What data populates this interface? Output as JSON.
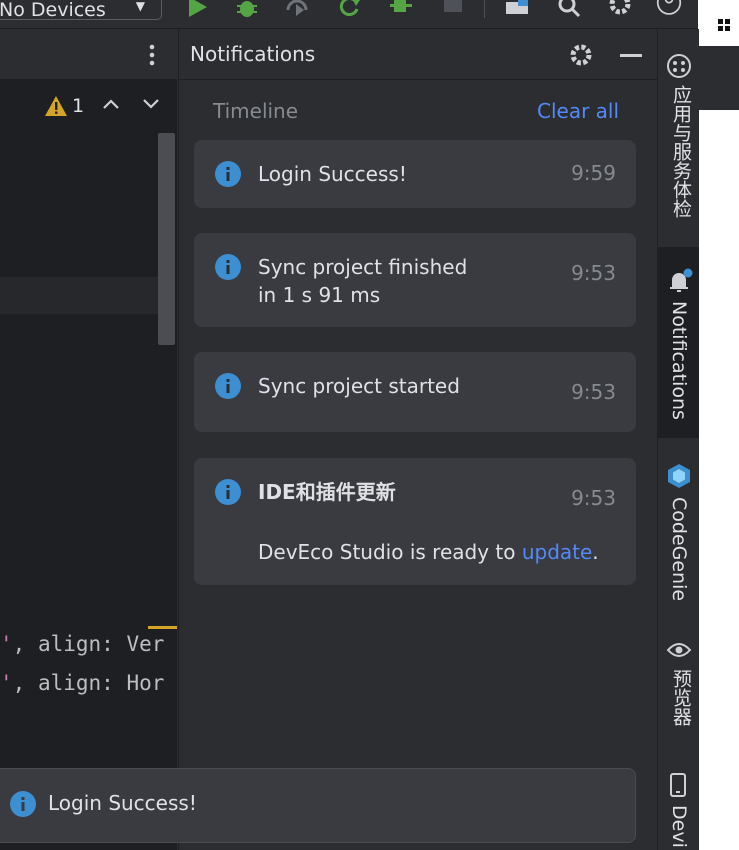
{
  "toolbar": {
    "device_label": "No Devices",
    "icons": [
      "run-icon",
      "debug-icon",
      "profile-icon",
      "apply-changes-icon",
      "apply-code-changes-icon",
      "stop-icon",
      "device-manager-icon",
      "search-icon",
      "settings-icon",
      "account-icon"
    ]
  },
  "editor": {
    "warning_count": "1",
    "code_lines": [
      {
        "quote": "'",
        "rest": ", align: Ver"
      },
      {
        "quote": "'",
        "rest": ", align: Hor"
      }
    ]
  },
  "notifications": {
    "title": "Notifications",
    "timeline_label": "Timeline",
    "clear_all": "Clear all",
    "items": [
      {
        "message": "Login Success!",
        "time": "9:59"
      },
      {
        "message_line1": "Sync project finished",
        "message_line2": "in 1 s 91 ms",
        "time": "9:53"
      },
      {
        "message": "Sync project started",
        "time": "9:53"
      },
      {
        "title": "IDE和插件更新",
        "body_prefix": "DevEco Studio is ready to ",
        "link": "update",
        "body_suffix": ".",
        "time": "9:53"
      }
    ]
  },
  "tool_strip": {
    "items": [
      {
        "label": "应用与服务体检",
        "icon": "health-check-icon"
      },
      {
        "label": "Notifications",
        "icon": "bell-icon"
      },
      {
        "label": "CodeGenie",
        "icon": "codegenie-icon"
      },
      {
        "label": "预览器",
        "icon": "eye-icon"
      },
      {
        "label": "Devi",
        "icon": "device-icon"
      }
    ]
  },
  "toast": {
    "message": "Login Success!"
  },
  "colors": {
    "accent": "#548af7",
    "info": "#3d8fd1",
    "run": "#55a546",
    "warning": "#d5a528"
  }
}
